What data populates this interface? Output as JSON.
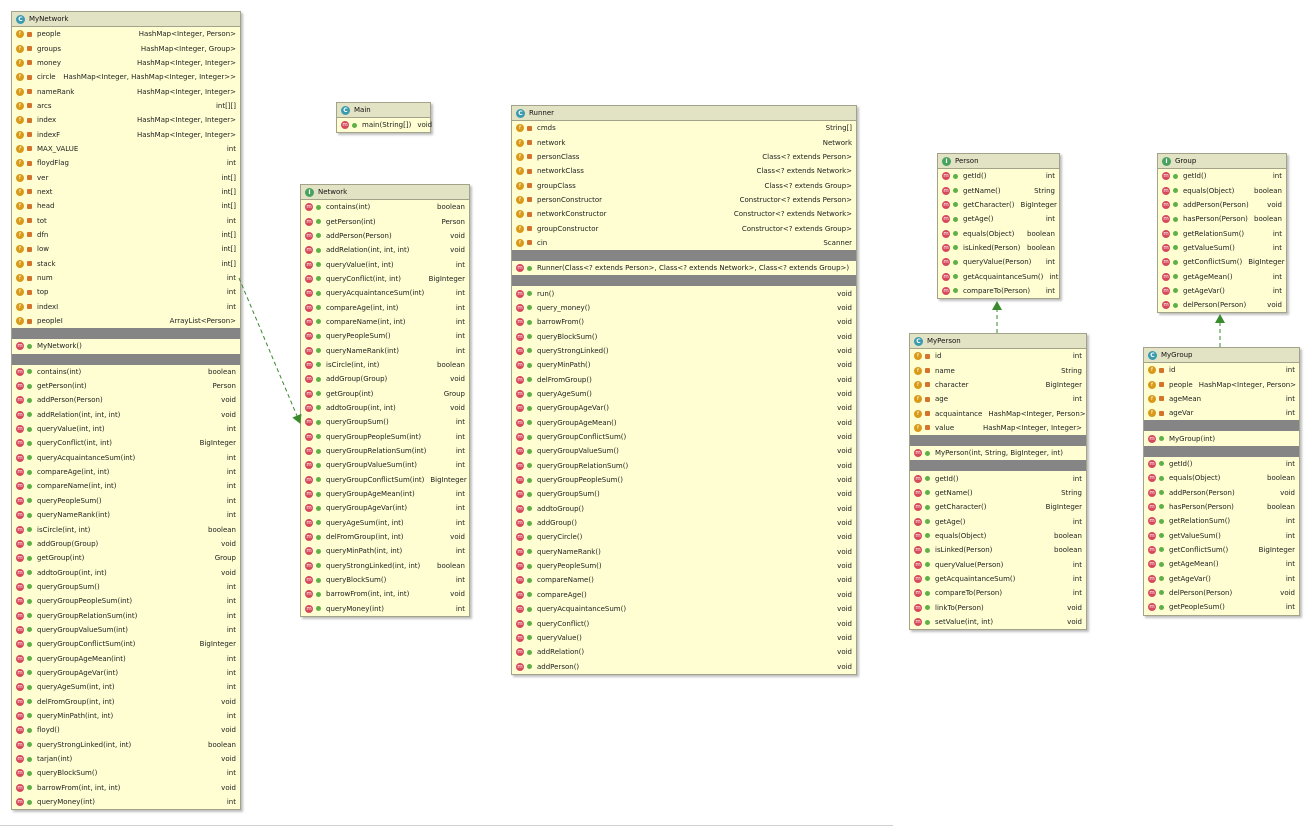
{
  "classes": {
    "mynetwork": {
      "name": "MyNetwork",
      "kind_letter": "C",
      "fields": [
        [
          "people",
          "HashMap<Integer, Person>"
        ],
        [
          "groups",
          "HashMap<Integer, Group>"
        ],
        [
          "money",
          "HashMap<Integer, Integer>"
        ],
        [
          "circle",
          "HashMap<Integer, HashMap<Integer, Integer>>"
        ],
        [
          "nameRank",
          "HashMap<Integer, Integer>"
        ],
        [
          "arcs",
          "int[][]"
        ],
        [
          "index",
          "HashMap<Integer, Integer>"
        ],
        [
          "indexF",
          "HashMap<Integer, Integer>"
        ],
        [
          "MAX_VALUE",
          "int"
        ],
        [
          "floydFlag",
          "int"
        ],
        [
          "ver",
          "int[]"
        ],
        [
          "next",
          "int[]"
        ],
        [
          "head",
          "int[]"
        ],
        [
          "tot",
          "int"
        ],
        [
          "dfn",
          "int[]"
        ],
        [
          "low",
          "int[]"
        ],
        [
          "stack",
          "int[]"
        ],
        [
          "num",
          "int"
        ],
        [
          "top",
          "int"
        ],
        [
          "indexI",
          "int"
        ],
        [
          "peopleI",
          "ArrayList<Person>"
        ]
      ],
      "constructors": [
        [
          "MyNetwork()",
          ""
        ]
      ],
      "methods": [
        [
          "contains(int)",
          "boolean"
        ],
        [
          "getPerson(int)",
          "Person"
        ],
        [
          "addPerson(Person)",
          "void"
        ],
        [
          "addRelation(int, int, int)",
          "void"
        ],
        [
          "queryValue(int, int)",
          "int"
        ],
        [
          "queryConflict(int, int)",
          "BigInteger"
        ],
        [
          "queryAcquaintanceSum(int)",
          "int"
        ],
        [
          "compareAge(int, int)",
          "int"
        ],
        [
          "compareName(int, int)",
          "int"
        ],
        [
          "queryPeopleSum()",
          "int"
        ],
        [
          "queryNameRank(int)",
          "int"
        ],
        [
          "isCircle(int, int)",
          "boolean"
        ],
        [
          "addGroup(Group)",
          "void"
        ],
        [
          "getGroup(int)",
          "Group"
        ],
        [
          "addtoGroup(int, int)",
          "void"
        ],
        [
          "queryGroupSum()",
          "int"
        ],
        [
          "queryGroupPeopleSum(int)",
          "int"
        ],
        [
          "queryGroupRelationSum(int)",
          "int"
        ],
        [
          "queryGroupValueSum(int)",
          "int"
        ],
        [
          "queryGroupConflictSum(int)",
          "BigInteger"
        ],
        [
          "queryGroupAgeMean(int)",
          "int"
        ],
        [
          "queryGroupAgeVar(int)",
          "int"
        ],
        [
          "queryAgeSum(int, int)",
          "int"
        ],
        [
          "delFromGroup(int, int)",
          "void"
        ],
        [
          "queryMinPath(int, int)",
          "int"
        ],
        [
          "floyd()",
          "void"
        ],
        [
          "queryStrongLinked(int, int)",
          "boolean"
        ],
        [
          "tarjan(int)",
          "void"
        ],
        [
          "queryBlockSum()",
          "int"
        ],
        [
          "barrowFrom(int, int, int)",
          "void"
        ],
        [
          "queryMoney(int)",
          "int"
        ]
      ]
    },
    "main": {
      "name": "Main",
      "kind_letter": "C",
      "fields": [],
      "constructors": [],
      "methods": [
        [
          "main(String[])",
          "void"
        ]
      ]
    },
    "network": {
      "name": "Network",
      "kind_letter": "I",
      "fields": [],
      "constructors": [],
      "methods": [
        [
          "contains(int)",
          "boolean"
        ],
        [
          "getPerson(int)",
          "Person"
        ],
        [
          "addPerson(Person)",
          "void"
        ],
        [
          "addRelation(int, int, int)",
          "void"
        ],
        [
          "queryValue(int, int)",
          "int"
        ],
        [
          "queryConflict(int, int)",
          "BigInteger"
        ],
        [
          "queryAcquaintanceSum(int)",
          "int"
        ],
        [
          "compareAge(int, int)",
          "int"
        ],
        [
          "compareName(int, int)",
          "int"
        ],
        [
          "queryPeopleSum()",
          "int"
        ],
        [
          "queryNameRank(int)",
          "int"
        ],
        [
          "isCircle(int, int)",
          "boolean"
        ],
        [
          "addGroup(Group)",
          "void"
        ],
        [
          "getGroup(int)",
          "Group"
        ],
        [
          "addtoGroup(int, int)",
          "void"
        ],
        [
          "queryGroupSum()",
          "int"
        ],
        [
          "queryGroupPeopleSum(int)",
          "int"
        ],
        [
          "queryGroupRelationSum(int)",
          "int"
        ],
        [
          "queryGroupValueSum(int)",
          "int"
        ],
        [
          "queryGroupConflictSum(int)",
          "BigInteger"
        ],
        [
          "queryGroupAgeMean(int)",
          "int"
        ],
        [
          "queryGroupAgeVar(int)",
          "int"
        ],
        [
          "queryAgeSum(int, int)",
          "int"
        ],
        [
          "delFromGroup(int, int)",
          "void"
        ],
        [
          "queryMinPath(int, int)",
          "int"
        ],
        [
          "queryStrongLinked(int, int)",
          "boolean"
        ],
        [
          "queryBlockSum()",
          "int"
        ],
        [
          "barrowFrom(int, int, int)",
          "void"
        ],
        [
          "queryMoney(int)",
          "int"
        ]
      ]
    },
    "runner": {
      "name": "Runner",
      "kind_letter": "C",
      "fields": [
        [
          "cmds",
          "String[]"
        ],
        [
          "network",
          "Network"
        ],
        [
          "personClass",
          "Class<? extends Person>"
        ],
        [
          "networkClass",
          "Class<? extends Network>"
        ],
        [
          "groupClass",
          "Class<? extends Group>"
        ],
        [
          "personConstructor",
          "Constructor<? extends Person>"
        ],
        [
          "networkConstructor",
          "Constructor<? extends Network>"
        ],
        [
          "groupConstructor",
          "Constructor<? extends Group>"
        ],
        [
          "cin",
          "Scanner"
        ]
      ],
      "constructors": [
        [
          "Runner(Class<? extends Person>, Class<? extends Network>, Class<? extends Group>)",
          ""
        ]
      ],
      "methods": [
        [
          "run()",
          "void"
        ],
        [
          "query_money()",
          "void"
        ],
        [
          "barrowFrom()",
          "void"
        ],
        [
          "queryBlockSum()",
          "void"
        ],
        [
          "queryStrongLinked()",
          "void"
        ],
        [
          "queryMinPath()",
          "void"
        ],
        [
          "delFromGroup()",
          "void"
        ],
        [
          "queryAgeSum()",
          "void"
        ],
        [
          "queryGroupAgeVar()",
          "void"
        ],
        [
          "queryGroupAgeMean()",
          "void"
        ],
        [
          "queryGroupConflictSum()",
          "void"
        ],
        [
          "queryGroupValueSum()",
          "void"
        ],
        [
          "queryGroupRelationSum()",
          "void"
        ],
        [
          "queryGroupPeopleSum()",
          "void"
        ],
        [
          "queryGroupSum()",
          "void"
        ],
        [
          "addtoGroup()",
          "void"
        ],
        [
          "addGroup()",
          "void"
        ],
        [
          "queryCircle()",
          "void"
        ],
        [
          "queryNameRank()",
          "void"
        ],
        [
          "queryPeopleSum()",
          "void"
        ],
        [
          "compareName()",
          "void"
        ],
        [
          "compareAge()",
          "void"
        ],
        [
          "queryAcquaintanceSum()",
          "void"
        ],
        [
          "queryConflict()",
          "void"
        ],
        [
          "queryValue()",
          "void"
        ],
        [
          "addRelation()",
          "void"
        ],
        [
          "addPerson()",
          "void"
        ]
      ]
    },
    "person": {
      "name": "Person",
      "kind_letter": "I",
      "fields": [],
      "constructors": [],
      "methods": [
        [
          "getId()",
          "int"
        ],
        [
          "getName()",
          "String"
        ],
        [
          "getCharacter()",
          "BigInteger"
        ],
        [
          "getAge()",
          "int"
        ],
        [
          "equals(Object)",
          "boolean"
        ],
        [
          "isLinked(Person)",
          "boolean"
        ],
        [
          "queryValue(Person)",
          "int"
        ],
        [
          "getAcquaintanceSum()",
          "int"
        ],
        [
          "compareTo(Person)",
          "int"
        ]
      ]
    },
    "myperson": {
      "name": "MyPerson",
      "kind_letter": "C",
      "fields": [
        [
          "id",
          "int"
        ],
        [
          "name",
          "String"
        ],
        [
          "character",
          "BigInteger"
        ],
        [
          "age",
          "int"
        ],
        [
          "acquaintance",
          "HashMap<Integer, Person>"
        ],
        [
          "value",
          "HashMap<Integer, Integer>"
        ]
      ],
      "constructors": [
        [
          "MyPerson(int, String, BigInteger, int)",
          ""
        ]
      ],
      "methods": [
        [
          "getId()",
          "int"
        ],
        [
          "getName()",
          "String"
        ],
        [
          "getCharacter()",
          "BigInteger"
        ],
        [
          "getAge()",
          "int"
        ],
        [
          "equals(Object)",
          "boolean"
        ],
        [
          "isLinked(Person)",
          "boolean"
        ],
        [
          "queryValue(Person)",
          "int"
        ],
        [
          "getAcquaintanceSum()",
          "int"
        ],
        [
          "compareTo(Person)",
          "int"
        ],
        [
          "linkTo(Person)",
          "void"
        ],
        [
          "setValue(int, int)",
          "void"
        ]
      ]
    },
    "group": {
      "name": "Group",
      "kind_letter": "I",
      "fields": [],
      "constructors": [],
      "methods": [
        [
          "getId()",
          "int"
        ],
        [
          "equals(Object)",
          "boolean"
        ],
        [
          "addPerson(Person)",
          "void"
        ],
        [
          "hasPerson(Person)",
          "boolean"
        ],
        [
          "getRelationSum()",
          "int"
        ],
        [
          "getValueSum()",
          "int"
        ],
        [
          "getConflictSum()",
          "BigInteger"
        ],
        [
          "getAgeMean()",
          "int"
        ],
        [
          "getAgeVar()",
          "int"
        ],
        [
          "delPerson(Person)",
          "void"
        ]
      ]
    },
    "mygroup": {
      "name": "MyGroup",
      "kind_letter": "C",
      "fields": [
        [
          "id",
          "int"
        ],
        [
          "people",
          "HashMap<Integer, Person>"
        ],
        [
          "ageMean",
          "int"
        ],
        [
          "ageVar",
          "int"
        ]
      ],
      "constructors": [
        [
          "MyGroup(int)",
          ""
        ]
      ],
      "methods": [
        [
          "getId()",
          "int"
        ],
        [
          "equals(Object)",
          "boolean"
        ],
        [
          "addPerson(Person)",
          "void"
        ],
        [
          "hasPerson(Person)",
          "boolean"
        ],
        [
          "getRelationSum()",
          "int"
        ],
        [
          "getValueSum()",
          "int"
        ],
        [
          "getConflictSum()",
          "BigInteger"
        ],
        [
          "getAgeMean()",
          "int"
        ],
        [
          "getAgeVar()",
          "int"
        ],
        [
          "delPerson(Person)",
          "void"
        ],
        [
          "getPeopleSum()",
          "int"
        ]
      ]
    }
  },
  "icons": {
    "field": "f",
    "method": "m"
  },
  "colors": {
    "box_fill": "#fefed2",
    "header_fill": "#e2e2c4",
    "separator": "#858585",
    "field_icon": "#d99a1a",
    "method_icon": "#d64a5c",
    "class_kind": "#3a9bb0",
    "interface_kind": "#49a360",
    "arrow": "#3a8a2e"
  }
}
